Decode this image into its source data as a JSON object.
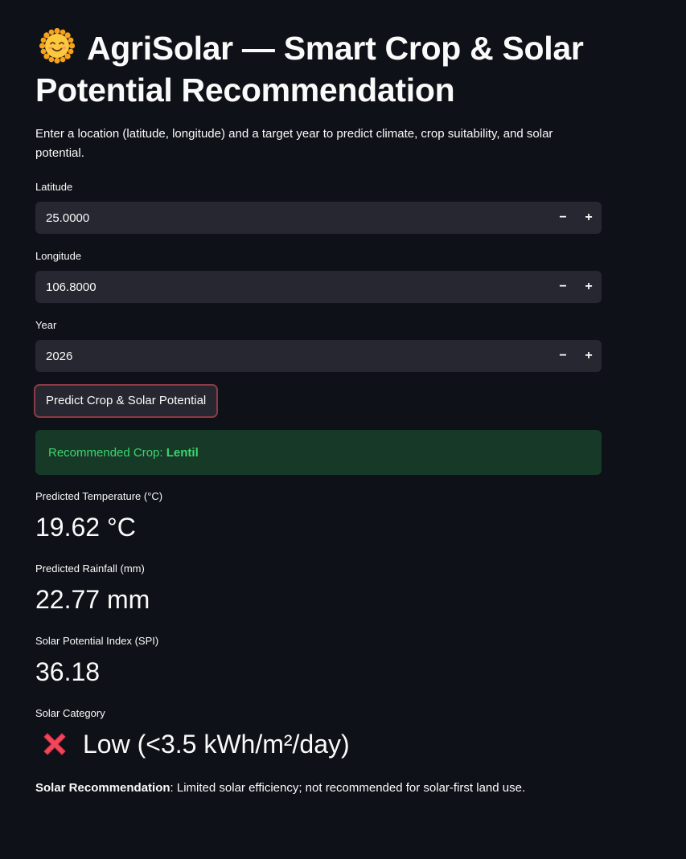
{
  "header": {
    "emoji": "smiling-sun-icon",
    "title": "AgriSolar — Smart Crop & Solar Potential Recommendation",
    "intro": "Enter a location (latitude, longitude) and a target year to predict climate, crop suitability, and solar potential."
  },
  "inputs": {
    "latitude": {
      "label": "Latitude",
      "value": "25.0000"
    },
    "longitude": {
      "label": "Longitude",
      "value": "106.8000"
    },
    "year": {
      "label": "Year",
      "value": "2026"
    },
    "minus": "−",
    "plus": "+"
  },
  "predict_button": "Predict Crop & Solar Potential",
  "result": {
    "crop_prefix": "Recommended Crop: ",
    "crop": "Lentil"
  },
  "metrics": {
    "temperature": {
      "label": "Predicted Temperature (°C)",
      "value": "19.62 °C"
    },
    "rainfall": {
      "label": "Predicted Rainfall (mm)",
      "value": "22.77 mm"
    },
    "spi": {
      "label": "Solar Potential Index (SPI)",
      "value": "36.18"
    },
    "category": {
      "label": "Solar Category",
      "icon": "red-cross-icon",
      "value": "Low (<3.5 kWh/m²/day)"
    }
  },
  "solar_recommendation": {
    "label": "Solar Recommendation",
    "text": ": Limited solar efficiency; not recommended for solar-first land use."
  },
  "colors": {
    "background": "#0e1117",
    "input_bg": "#262730",
    "success_bg": "#173928",
    "success_text": "#3dd56d",
    "button_border": "#8c3b44"
  }
}
